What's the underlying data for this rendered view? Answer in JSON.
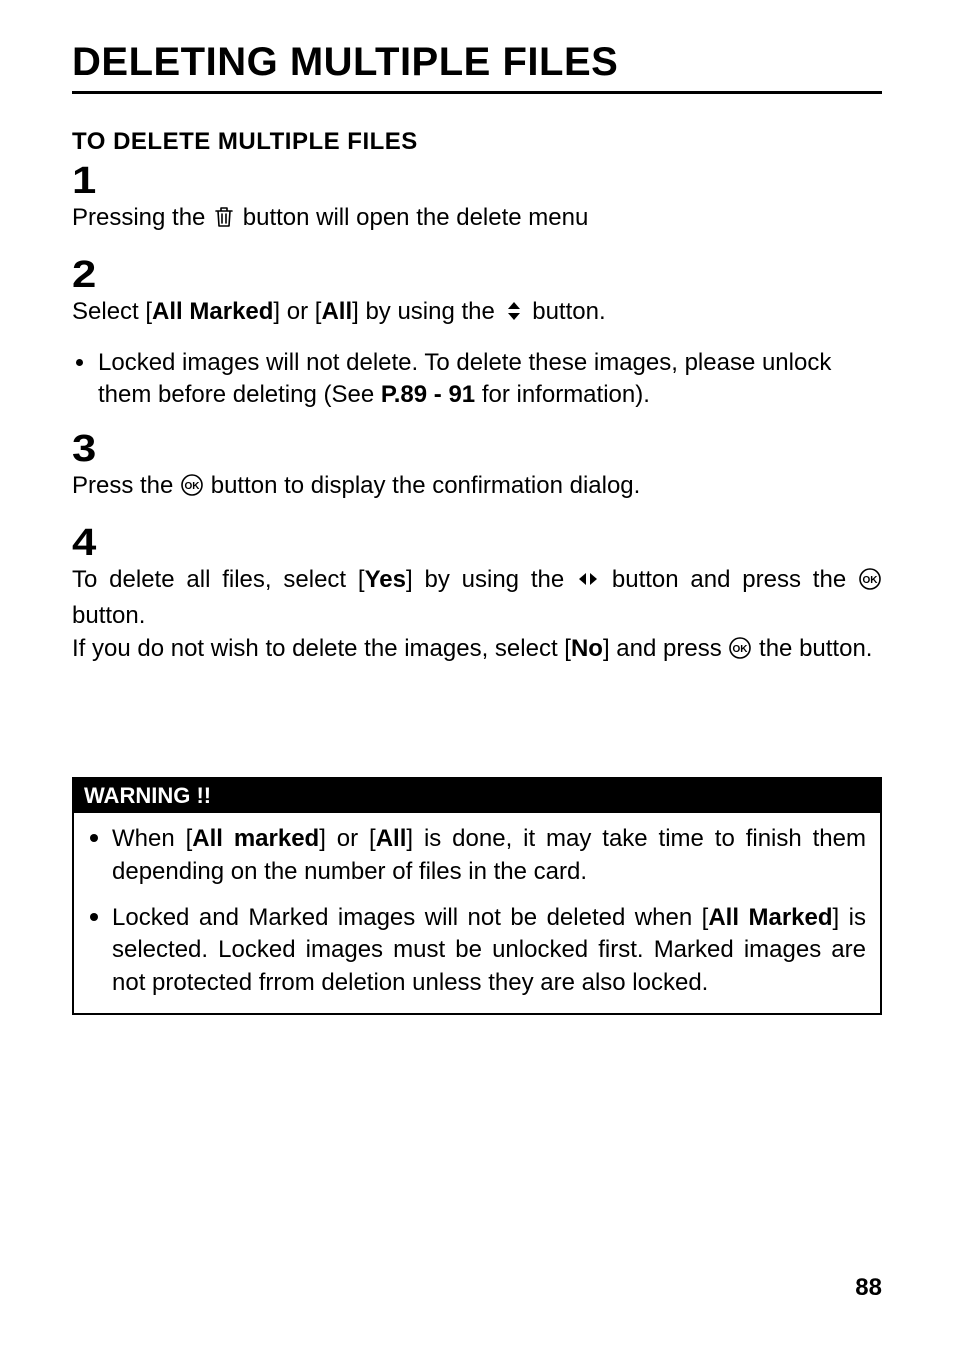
{
  "title": "DELETING MULTIPLE FILES",
  "section_title": "TO DELETE MULTIPLE FILES",
  "steps": {
    "s1": {
      "num": "1",
      "pre": "Pressing the ",
      "icon": "trash-icon",
      "post": " button will open the delete menu"
    },
    "s2": {
      "num": "2",
      "pre": "Select [",
      "b1": "All Marked",
      "mid1": "] or [",
      "b2": "All",
      "mid2": "] by using the ",
      "icon": "updown-icon",
      "post": " button.",
      "sub_pre": "Locked images will not delete. To delete these images, please unlock them before deleting (See ",
      "sub_bold": "P.89 - 91",
      "sub_post": " for information)."
    },
    "s3": {
      "num": "3",
      "pre": "Press the ",
      "icon": "ok-icon",
      "post": " button to display the confirmation dialog."
    },
    "s4": {
      "num": "4",
      "l1_pre": "To delete all files, select [",
      "l1_b": "Yes",
      "l1_mid": "] by using the ",
      "l1_icon": "leftright-icon",
      "l1_mid2": " button and press the ",
      "l1_icon2": "ok-icon",
      "l1_post": " button.",
      "l2_pre": "If you do not wish to delete the images, select [",
      "l2_b": "No",
      "l2_mid": "] and press ",
      "l2_icon": "ok-icon",
      "l2_post": " the button."
    }
  },
  "warning": {
    "header": "WARNING !!",
    "w1": {
      "pre": "When [",
      "b1": "All marked",
      "mid": "] or [",
      "b2": "All",
      "post": "] is done, it may take time to finish them depending on the number of files in the card."
    },
    "w2": {
      "pre": "Locked and Marked images will not be deleted when [",
      "b1": "All Marked",
      "post": "] is selected. Locked images must be unlocked first. Marked images are not protected frrom deletion unless they are also locked."
    }
  },
  "page_number": "88"
}
